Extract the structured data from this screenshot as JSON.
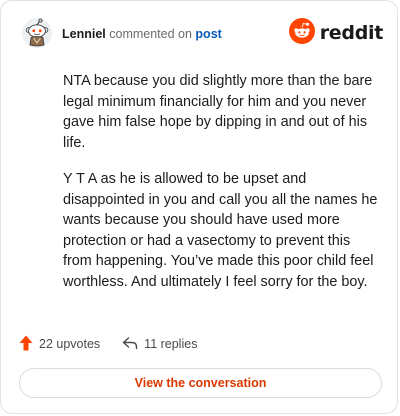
{
  "comment": {
    "username": "Lenniel",
    "verb": "commented on",
    "target_link": "post",
    "paragraphs": [
      "NTA because you did slightly more than the bare legal minimum financially for him and you never gave him false hope by dipping in and out of his life.",
      "Y T A as he is allowed to be upset and disappointed in you and call you all the names he wants because you should have used more protection or had a vasectomy to prevent this from happening. You’ve made this poor child feel worthless. And ultimately I feel sorry for the boy."
    ]
  },
  "brand": {
    "wordmark": "reddit",
    "icon": "reddit-snoo-icon",
    "accent": "#ff4500"
  },
  "footer": {
    "upvotes_label": "22 upvotes",
    "upvote_icon": "upvote-arrow-icon",
    "upvote_color": "#ff4500",
    "replies_label": "11 replies",
    "reply_icon": "reply-arrow-icon"
  },
  "cta": {
    "label": "View the conversation",
    "color": "#d93900"
  },
  "avatar": {
    "icon": "snoo-avatar-icon"
  }
}
